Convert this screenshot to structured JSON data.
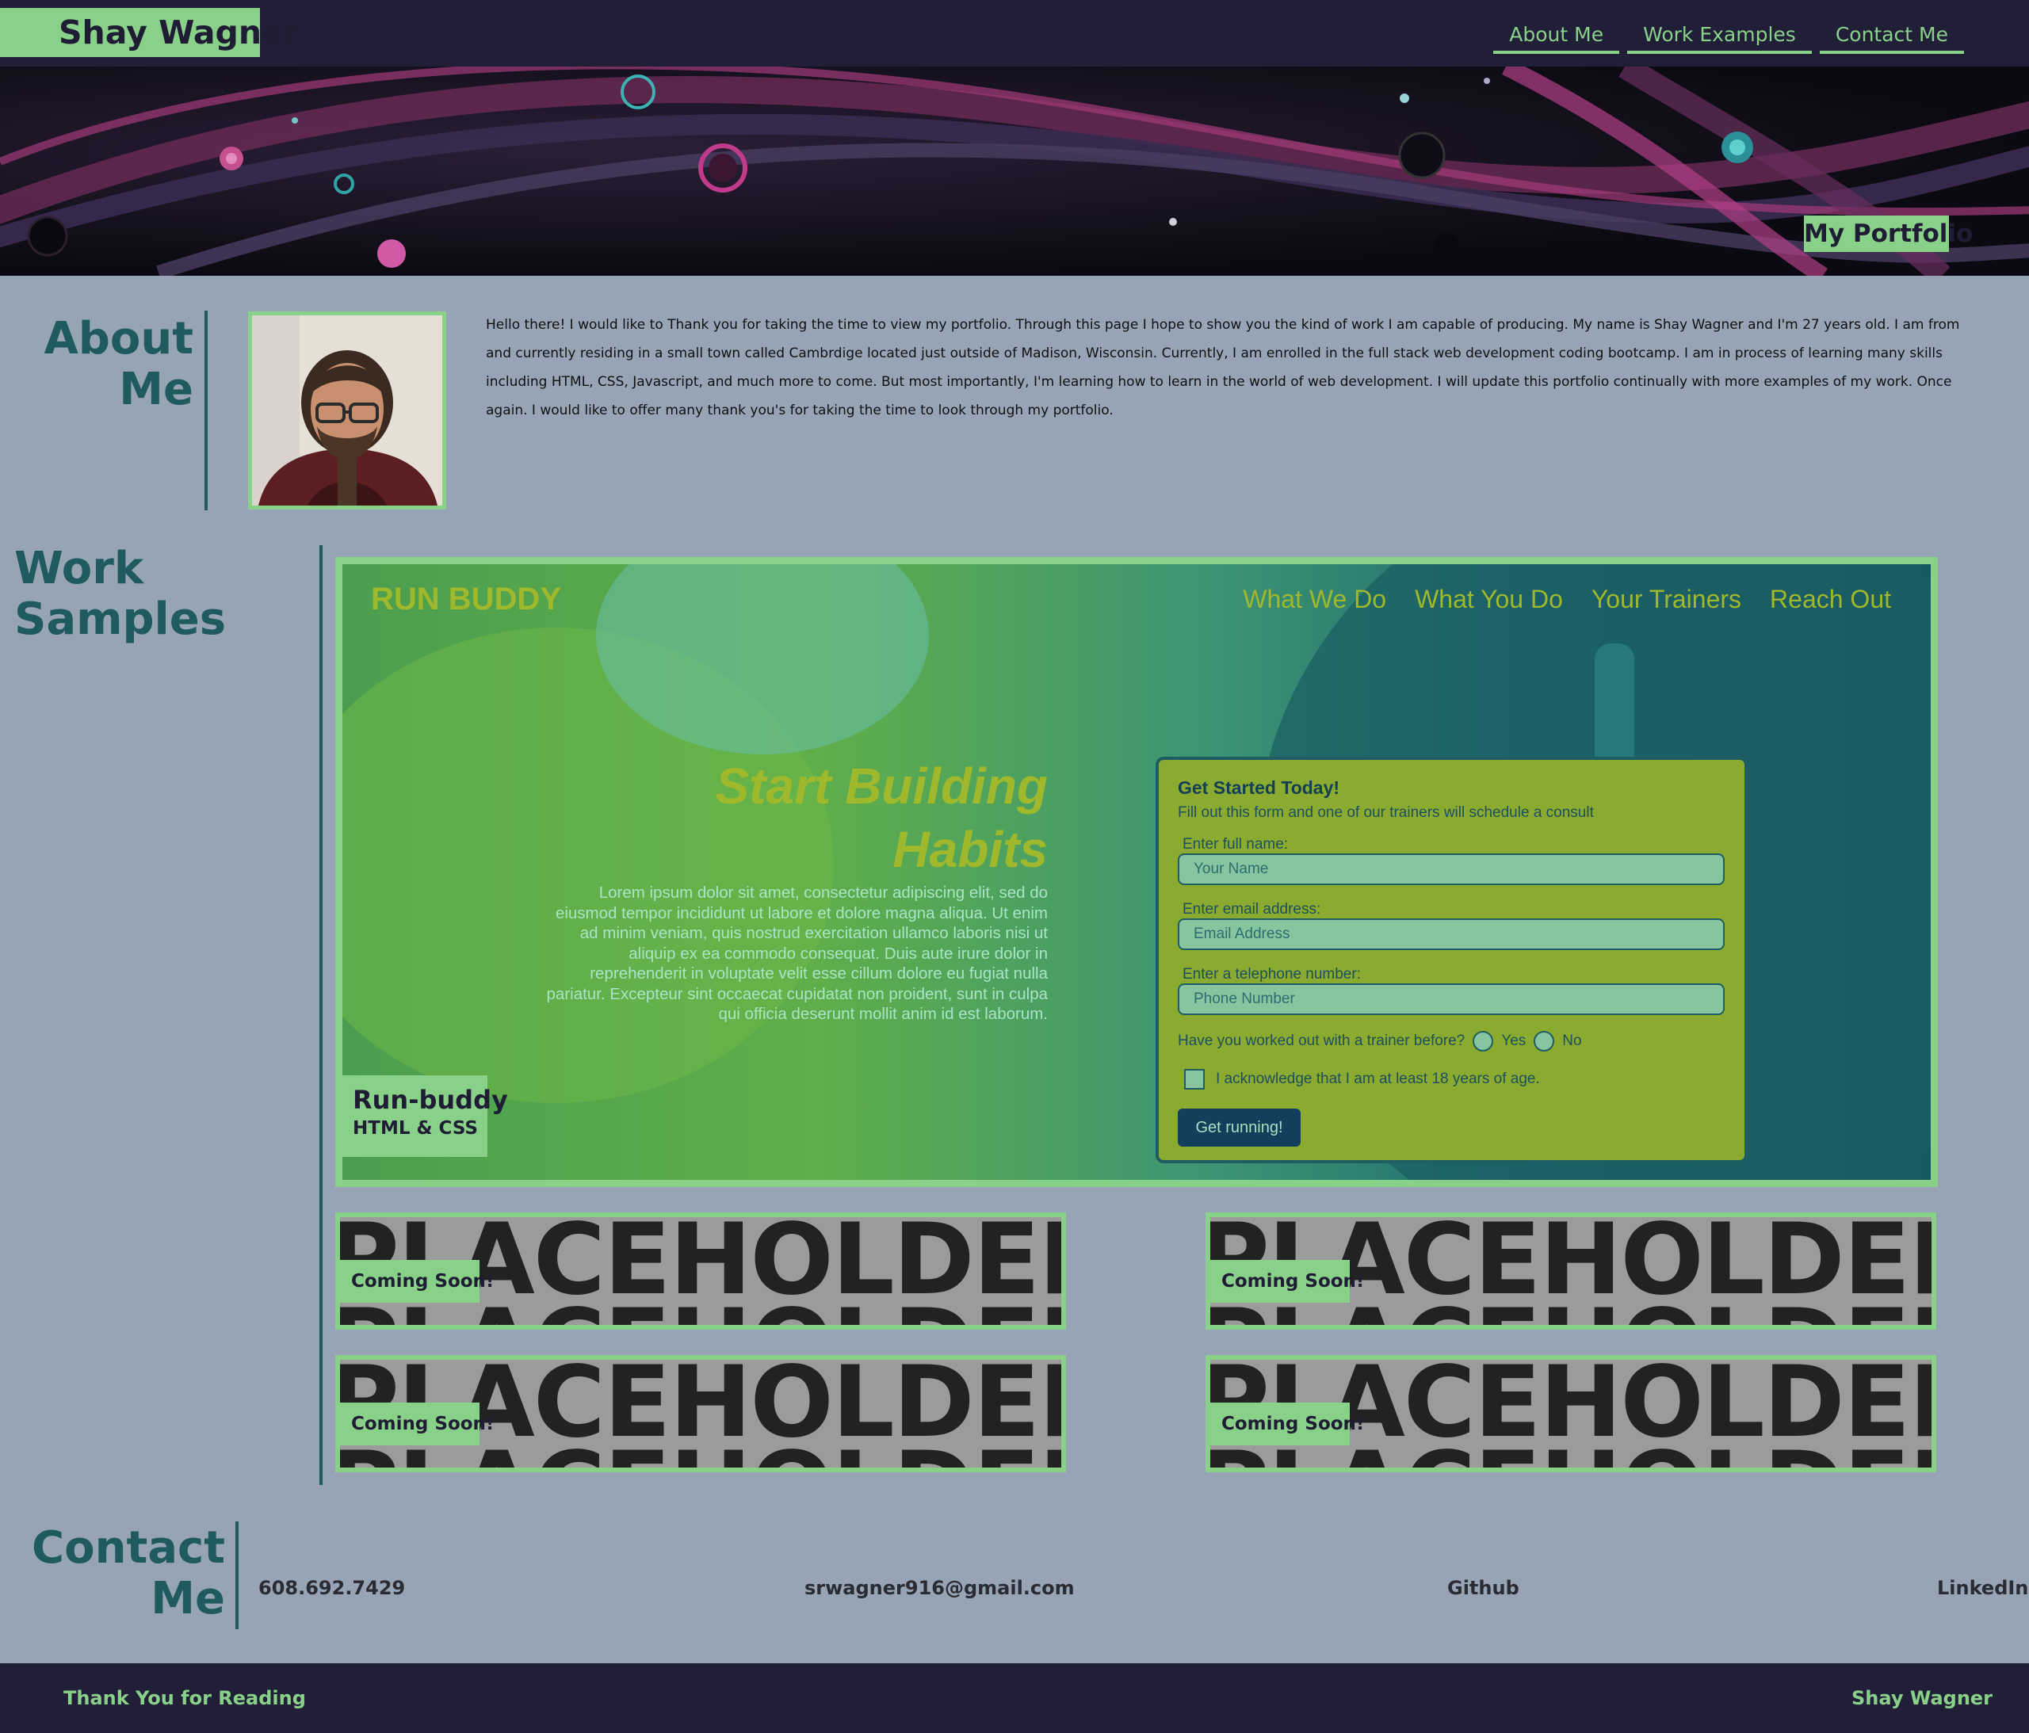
{
  "header": {
    "brand": "Shay Wagner",
    "nav": [
      "About Me",
      "Work Examples",
      "Contact Me"
    ],
    "hero_tag": "My Portfolio"
  },
  "about": {
    "title_line1": "About",
    "title_line2": "Me",
    "photo_alt": "Portrait of Shay Wagner",
    "text": "Hello there! I would like to Thank you for taking the time to view my portfolio. Through this page I hope to show you the kind of work I am capable of producing. My name is Shay Wagner and I'm 27 years old. I am from and currently residing in a small town called Cambrdige located just outside of Madison, Wisconsin. Currently, I am enrolled in the full stack web development coding bootcamp. I am in process of learning many skills including HTML, CSS, Javascript, and much more to come. But most importantly, I'm learning how to learn in the world of web development. I will update this portfolio continually with more examples of my work. Once again. I would like to offer many thank you's for taking the time to look through my portfolio."
  },
  "work": {
    "title": "Work Samples",
    "featured": {
      "logo": "RUN BUDDY",
      "nav": [
        "What We Do",
        "What You Do",
        "Your Trainers",
        "Reach Out"
      ],
      "headline_line1": "Start Building",
      "headline_line2": "Habits",
      "lorem": "Lorem ipsum dolor sit amet, consectetur adipiscing elit, sed do eiusmod tempor incididunt ut labore et dolore magna aliqua. Ut enim ad minim veniam, quis nostrud exercitation ullamco laboris nisi ut aliquip ex ea commodo consequat. Duis aute irure dolor in reprehenderit in voluptate velit esse cillum dolore eu fugiat nulla pariatur. Excepteur sint occaecat cupidatat non proident, sunt in culpa qui officia deserunt mollit anim id est laborum.",
      "form": {
        "title": "Get Started Today!",
        "subtitle": "Fill out this form and one of our trainers will schedule a consult",
        "name_label": "Enter full name:",
        "name_placeholder": "Your Name",
        "email_label": "Enter email address:",
        "email_placeholder": "Email Address",
        "phone_label": "Enter a telephone number:",
        "phone_placeholder": "Phone Number",
        "question": "Have you worked out with a trainer before?",
        "yes": "Yes",
        "no": "No",
        "acknowledge": "I acknowledge that I am at least 18 years of age.",
        "button": "Get running!"
      },
      "caption_title": "Run-buddy",
      "caption_sub": "HTML & CSS"
    },
    "placeholders": [
      {
        "image_text": "PLACEHOLDERP",
        "badge": "Coming Soon!"
      },
      {
        "image_text": "PLACEHOLDERP",
        "badge": "Coming Soon!"
      },
      {
        "image_text": "PLACEHOLDERP",
        "badge": "Coming Soon!"
      },
      {
        "image_text": "PLACEHOLDERP",
        "badge": "Coming Soon!"
      }
    ]
  },
  "contact": {
    "title_line1": "Contact",
    "title_line2": "Me",
    "phone": "608.692.7429",
    "email": "srwagner916@gmail.com",
    "github": "Github",
    "linkedin": "LinkedIn"
  },
  "footer": {
    "left": "Thank You for Reading",
    "right": "Shay Wagner"
  },
  "colors": {
    "accent": "#89d189",
    "navy": "#211f38",
    "background": "#96a4b6",
    "heading": "#1f5b5e"
  }
}
